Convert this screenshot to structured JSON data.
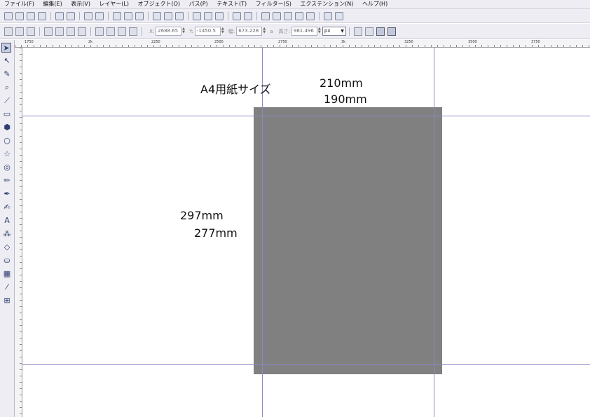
{
  "menu": {
    "items": [
      "ファイル(F)",
      "編集(E)",
      "表示(V)",
      "レイヤー(L)",
      "オブジェクト(O)",
      "パス(P)",
      "テキスト(T)",
      "フィルター(S)",
      "エクステンション(N)",
      "ヘルプ(H)"
    ]
  },
  "controls": {
    "x_label": "X:",
    "x_value": "2688.65",
    "y_label": "Y:",
    "y_value": "-1450.5",
    "w_label": "幅:",
    "w_value": "673.228",
    "h_label": "高さ:",
    "h_value": "981.496",
    "unit": "px"
  },
  "ruler": {
    "labels": [
      "1750",
      "2k",
      "2250",
      "2500",
      "2750",
      "3k",
      "3250",
      "3500",
      "3750"
    ]
  },
  "canvas": {
    "title": "A4用紙サイズ",
    "width_mm": "210mm",
    "width_inner_mm": "190mm",
    "height_mm": "297mm",
    "height_inner_mm": "277mm",
    "page_color": "#808080",
    "guide_color": "#8a8ac4"
  }
}
